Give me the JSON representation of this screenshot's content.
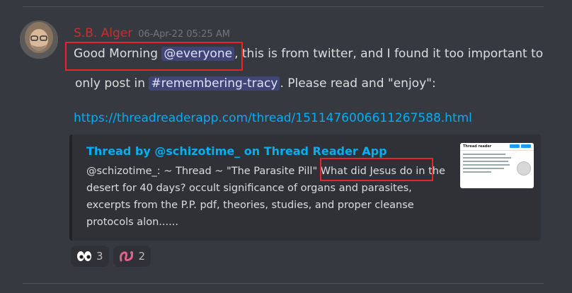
{
  "message": {
    "author": "S.B. Alger",
    "timestamp": "06-Apr-22 05:25 AM",
    "line1": {
      "prefix": "Good Morning ",
      "mention": "@everyone",
      "suffix": ", this is from twitter, and I found it too important to"
    },
    "line2": {
      "prefix": "only post in ",
      "channel": "#remembering-tracy",
      "suffix": ". Please read and \"enjoy\":"
    },
    "link": "https://threadreaderapp.com/thread/1511476006611267588.html"
  },
  "embed": {
    "title": "Thread by @schizotime_ on Thread Reader App",
    "description": "@schizotime_: ~ Thread ~ \"The Parasite Pill\" What did Jesus do in the desert for 40 days? occult significance of organs and parasites, excerpts from the P.P. pdf, theories, studies, and proper cleanse protocols alon......",
    "thumbnail_header": "Thread reader"
  },
  "reactions": [
    {
      "emoji": "eyes-icon",
      "count": "3"
    },
    {
      "emoji": "parasite-icon",
      "count": "2"
    }
  ],
  "colors": {
    "background": "#36393f",
    "author": "#c2332f",
    "link": "#00aff4",
    "highlight_box": "#e8242a"
  }
}
